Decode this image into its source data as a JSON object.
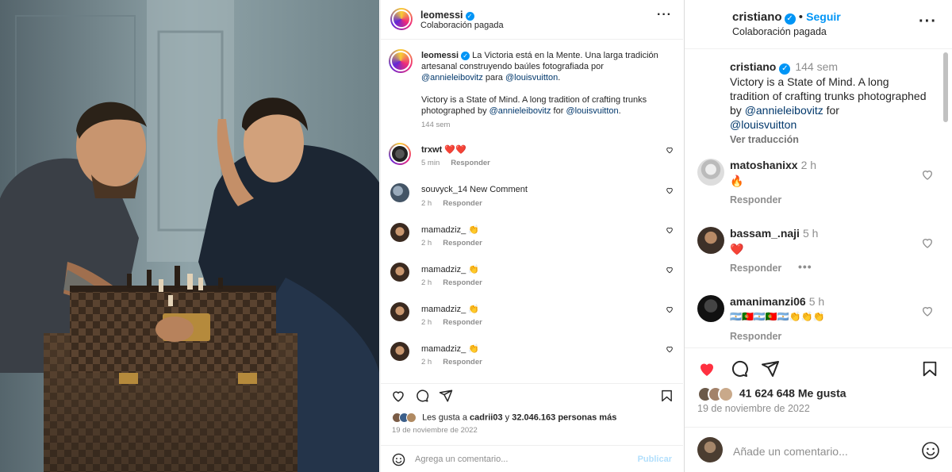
{
  "post_left": {
    "header": {
      "username": "leomessi",
      "verified_icon": "verified-badge-icon",
      "subtitle": "Colaboración pagada",
      "more_icon": "more-horizontal-icon"
    },
    "caption": {
      "username": "leomessi",
      "text_es_1": "La Victoria está en la Mente. Una larga tradición artesanal construyendo baúles fotografiada por",
      "mention_1": "@annieleibovitz",
      "para": "para",
      "mention_2": "@louisvuitton",
      "text_en": "Victory is a State of Mind. A long tradition of crafting trunks photographed by",
      "mention_3": "@annieleibovitz",
      "for": "for",
      "mention_4": "@louisvuitton",
      "time": "144 sem"
    },
    "comments": [
      {
        "user": "trxwt",
        "text": "❤️❤️",
        "time": "5 min",
        "reply": "Responder"
      },
      {
        "user": "souvyck_14",
        "text": "New Comment",
        "time": "2 h",
        "reply": "Responder"
      },
      {
        "user": "mamadziz_",
        "text": "👏",
        "time": "2 h",
        "reply": "Responder"
      },
      {
        "user": "mamadziz_",
        "text": "👏",
        "time": "2 h",
        "reply": "Responder"
      },
      {
        "user": "mamadziz_",
        "text": "👏",
        "time": "2 h",
        "reply": "Responder"
      },
      {
        "user": "mamadziz_",
        "text": "👏",
        "time": "2 h",
        "reply": "Responder"
      }
    ],
    "likes": {
      "prefix": "Les gusta a",
      "user": "cadrii03",
      "and": "y",
      "count": "32.046.163 personas más"
    },
    "date": "19 de noviembre de 2022",
    "add_comment": {
      "placeholder": "Agrega un comentario...",
      "publish": "Publicar",
      "emoji_icon": "emoji-icon"
    }
  },
  "post_right": {
    "header": {
      "username": "cristiano",
      "follow": "Seguir",
      "bullet": "•",
      "subtitle": "Colaboración pagada"
    },
    "caption": {
      "username": "cristiano",
      "time": "144 sem",
      "text": "Victory is a State of Mind. A long tradition of crafting trunks photographed by",
      "mention_1": "@annieleibovitz",
      "for": "for",
      "mention_2": "@louisvuitton",
      "translate": "Ver traducción"
    },
    "comments": [
      {
        "user": "matoshanixx",
        "time": "2 h",
        "text": "🔥",
        "reply": "Responder"
      },
      {
        "user": "bassam_.naji",
        "time": "5 h",
        "text": "❤️",
        "reply": "Responder",
        "more": "•••"
      },
      {
        "user": "amanimanzi06",
        "time": "5 h",
        "text": "🇦🇷🇵🇹🇦🇷🇵🇹🇦🇷👏👏👏",
        "reply": "Responder"
      }
    ],
    "likes": "41 624 648 Me gusta",
    "date": "19 de noviembre de 2022",
    "add_comment": {
      "placeholder": "Añade un comentario..."
    }
  },
  "colors": {
    "link": "#00376b",
    "blue": "#0095f6",
    "muted": "#8e8e8e",
    "heart_red": "#ff3040"
  }
}
